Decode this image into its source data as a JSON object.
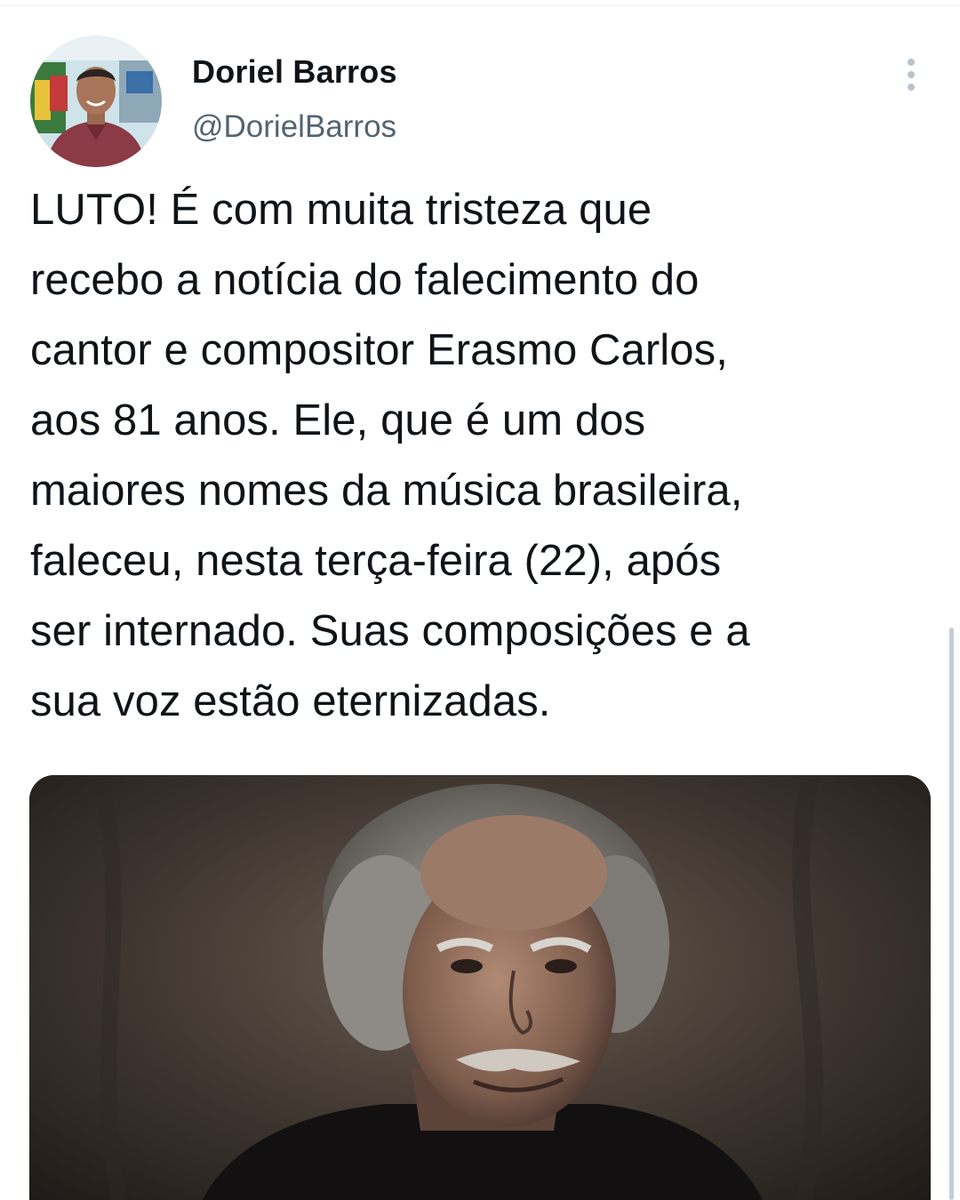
{
  "tweet": {
    "author": {
      "display_name": "Doriel Barros",
      "handle": "@DorielBarros"
    },
    "text": "LUTO! É com muita tristeza que\nrecebo a notícia do falecimento do\ncantor e compositor Erasmo Carlos,\naos 81 anos. Ele, que é um dos\nmaiores nomes da música brasileira,\nfaleceu, nesta terça-feira (22), após\nser internado. Suas composições e a\nsua voz estão eternizadas.",
    "more_icon": "more-vertical-icon"
  },
  "colors": {
    "text_primary": "#0f1419",
    "text_secondary": "#536471",
    "icon_gray": "#b9c3cc"
  }
}
